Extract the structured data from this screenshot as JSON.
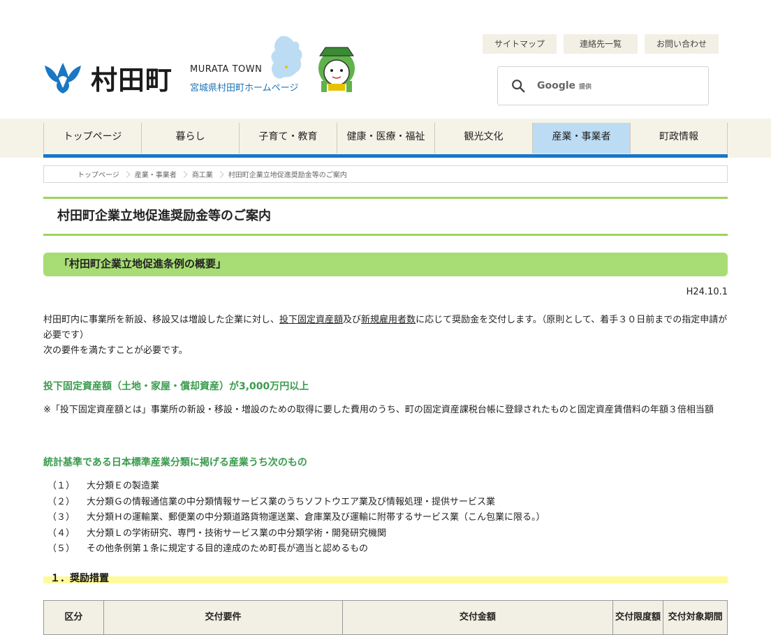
{
  "header": {
    "logo_text": "村田町",
    "town_en": "MURATA TOWN",
    "town_jp": "宮城県村田町ホームページ",
    "util_links": [
      "サイトマップ",
      "連絡先一覧",
      "お問い合わせ"
    ],
    "search_brand": "Google",
    "search_suffix": "提供"
  },
  "nav": {
    "items": [
      "トップページ",
      "暮らし",
      "子育て・教育",
      "健康・医療・福祉",
      "観光文化",
      "産業・事業者",
      "町政情報"
    ],
    "active_index": 5
  },
  "breadcrumb": [
    "トップページ",
    "産業・事業者",
    "商工業",
    "村田町企業立地促進奨励金等のご案内"
  ],
  "page": {
    "title": "村田町企業立地促進奨励金等のご案内",
    "section_title": "「村田町企業立地促進条例の概要」",
    "date": "H24.10.1",
    "intro_a": "村田町内に事業所を新設、移設又は増設した企業に対し、",
    "intro_link1": "投下固定資産額",
    "intro_b": "及び",
    "intro_link2": "新規雇用者数",
    "intro_c": "に応じて奨励金を交付します。（原則として、着手３０日前までの指定申請が必要です）",
    "requirement": "次の要件を満たすことが必要です。",
    "heading1": "投下固定資産額（土地・家屋・償却資産）が3,000万円以上",
    "note": "※「投下固定資産額とは」事業所の新設・移設・増設のための取得に要した費用のうち、町の固定資産課税台帳に登録されたものと固定資産賃借料の年額３倍相当額",
    "heading2": "統計基準である日本標準産業分類に掲げる産業うち次のもの",
    "list": [
      {
        "num": "（１）",
        "text": "大分類Ｅの製造業"
      },
      {
        "num": "（２）",
        "text": "大分類Ｇの情報通信業の中分類情報サービス業のうちソフトウエア業及び情報処理・提供サービス業"
      },
      {
        "num": "（３）",
        "text": "大分類Ｈの運輸業、郵便業の中分類道路貨物運送業、倉庫業及び運輸に附帯するサービス業（こん包業に限る。）"
      },
      {
        "num": "（４）",
        "text": "大分類Ｌの学術研究、専門・技術サービス業の中分類学術・開発研究機関"
      },
      {
        "num": "（５）",
        "text": "その他条例第１条に規定する目的達成のため町長が適当と認めるもの"
      }
    ],
    "heading3": "１．奨励措置",
    "table_headers": [
      "区分",
      "交付要件",
      "交付金額",
      "交付限度額",
      "交付対象期間"
    ]
  },
  "colors": {
    "green_line": "#9ed35a",
    "section_bg": "#a8dc74",
    "nav_active": "#bcdcf4",
    "nav_line": "#1777c9",
    "heading_green": "#3a9c4e",
    "highlight_yellow": "#fffa9c"
  }
}
